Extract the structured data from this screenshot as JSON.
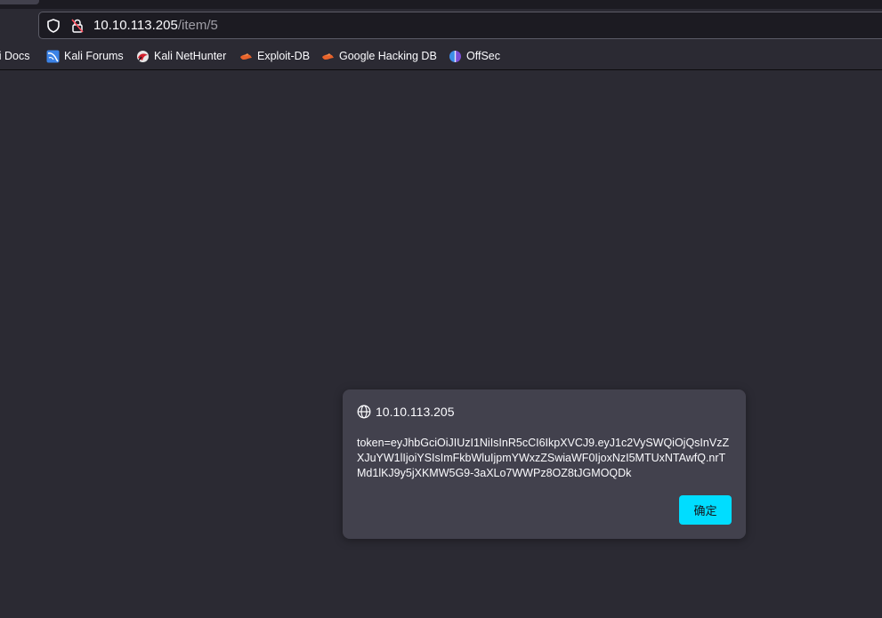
{
  "browser": {
    "url": {
      "host": "10.10.113.205",
      "path": "/item/5"
    },
    "bookmarks": [
      {
        "label": "li Docs",
        "icon": "kali-docs-icon"
      },
      {
        "label": "Kali Forums",
        "icon": "kali-forums-icon"
      },
      {
        "label": "Kali NetHunter",
        "icon": "kali-nethunter-icon"
      },
      {
        "label": "Exploit-DB",
        "icon": "exploit-db-icon"
      },
      {
        "label": "Google Hacking DB",
        "icon": "google-hacking-db-icon"
      },
      {
        "label": "OffSec",
        "icon": "offsec-icon"
      }
    ]
  },
  "dialog": {
    "origin": "10.10.113.205",
    "message": "token=eyJhbGciOiJIUzI1NiIsInR5cCI6IkpXVCJ9.eyJ1c2VySWQiOjQsInVzZXJuYW1lIjoiYSIsImFkbWluIjpmYWxzZSwiaWF0IjoxNzI5MTUxNTAwfQ.nrTMd1lKJ9y5jXKMW5G9-3aXLo7WWPz8OZ8tJGMOQDk",
    "ok_label": "确定"
  },
  "colors": {
    "page_bg": "#2b2a33",
    "dialog_bg": "#42414d",
    "accent": "#00ddff"
  }
}
